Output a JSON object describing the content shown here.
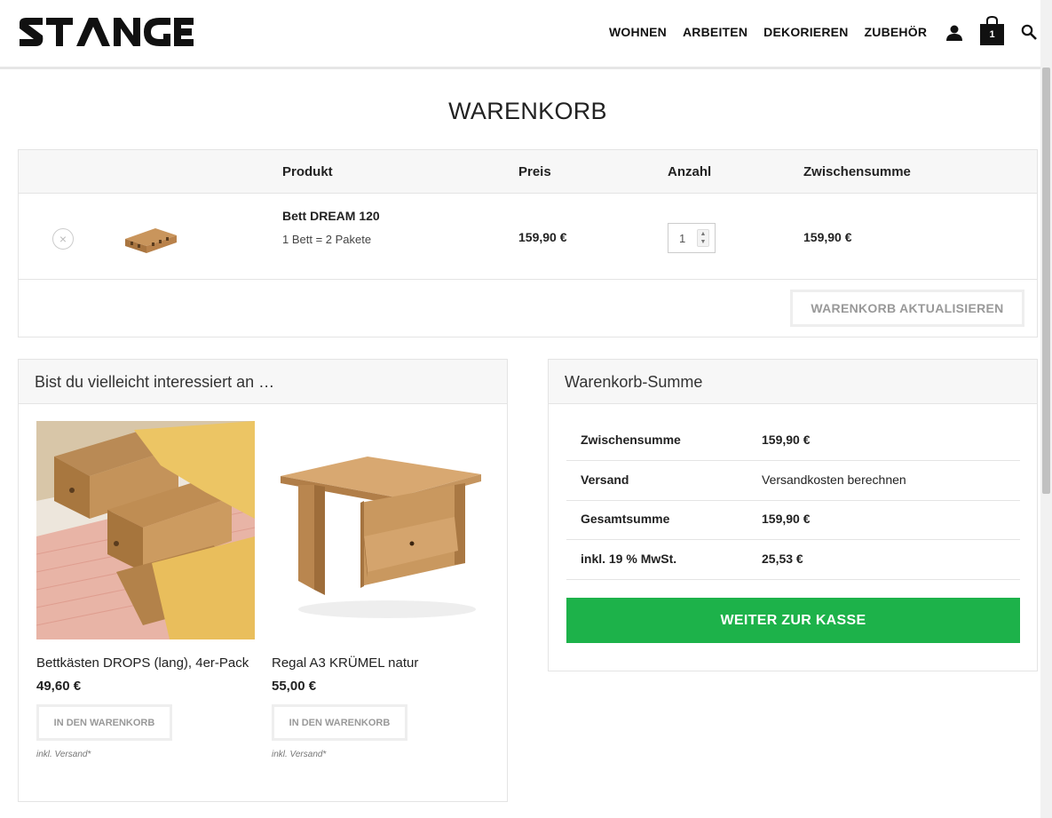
{
  "header": {
    "logo_text": "STANGE",
    "nav": [
      "WOHNEN",
      "ARBEITEN",
      "DEKORIEREN",
      "ZUBEHÖR"
    ],
    "cart_count": "1",
    "icons": [
      "user-icon",
      "shopping-bag-icon",
      "search-icon"
    ]
  },
  "page": {
    "title": "WARENKORB"
  },
  "cart": {
    "columns": [
      "Produkt",
      "Preis",
      "Anzahl",
      "Zwischensumme"
    ],
    "items": [
      {
        "name": "Bett DREAM 120",
        "meta": "1 Bett = 2 Pakete",
        "price": "159,90 €",
        "quantity": "1",
        "subtotal": "159,90 €"
      }
    ],
    "update_label": "WARENKORB AKTUALISIEREN",
    "remove_symbol": "×"
  },
  "cross_sells": {
    "title": "Bist du vielleicht interessiert an …",
    "products": [
      {
        "name": "Bettkästen DROPS (lang), 4er-Pack",
        "price": "49,60 €",
        "button": "IN DEN WARENKORB",
        "shipping": "inkl. Versand*"
      },
      {
        "name": "Regal A3 KRÜMEL natur",
        "price": "55,00 €",
        "button": "IN DEN WARENKORB",
        "shipping": "inkl. Versand*"
      }
    ]
  },
  "totals": {
    "title": "Warenkorb-Summe",
    "rows": [
      {
        "label": "Zwischensumme",
        "value": "159,90 €"
      },
      {
        "label": "Versand",
        "value": "Versandkosten berechnen"
      },
      {
        "label": "Gesamtsumme",
        "value": "159,90 €"
      },
      {
        "label": "inkl. 19 % MwSt.",
        "value": "25,53 €"
      }
    ],
    "checkout_label": "WEITER ZUR KASSE"
  },
  "colors": {
    "accent_green": "#1db24a",
    "text": "#222222",
    "border": "#e4e4e4",
    "header_bg": "#f7f7f7"
  }
}
